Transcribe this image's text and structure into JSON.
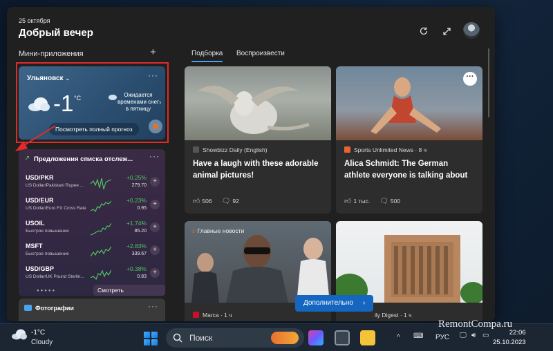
{
  "board": {
    "date": "25 октября",
    "greeting": "Добрый вечер",
    "widgets_title": "Мини-приложения",
    "add_symbol": "+",
    "tabs": [
      {
        "label": "Подборка",
        "active": true
      },
      {
        "label": "Воспроизвести",
        "active": false
      }
    ],
    "header_icons": [
      "refresh-icon",
      "expand-icon",
      "avatar"
    ]
  },
  "weather": {
    "city": "Ульяновск",
    "temp": "-1",
    "unit": "°C",
    "forecast": "Ожидается временами снег в пятницу",
    "button": "Посмотреть полный прогноз",
    "more": "···"
  },
  "watchlist": {
    "title": "Предложения списка отслеж...",
    "more": "···",
    "items": [
      {
        "ticker": "USD/PKR",
        "name": "US Dollar/Pakistani Rupee ...",
        "change": "+0.25%",
        "price": "279.70"
      },
      {
        "ticker": "USD/EUR",
        "name": "US Dollar/Euro FX Cross Rate",
        "change": "+0.23%",
        "price": "0.95"
      },
      {
        "ticker": "USOIL",
        "name": "Быстрое повышение",
        "change": "+1.74%",
        "price": "85.20"
      },
      {
        "ticker": "MSFT",
        "name": "Быстрое повышение",
        "change": "+2.83%",
        "price": "339.67"
      },
      {
        "ticker": "USD/GBP",
        "name": "US Dollar/UK Pound Sterlin...",
        "change": "+0.38%",
        "price": "0.83"
      }
    ],
    "add_symbol": "+",
    "see_more": "Смотреть предложени...",
    "dots": "●●●●●"
  },
  "photos": {
    "title": "Фотографии",
    "more": "···"
  },
  "cards": [
    {
      "source": "Showbizz Daily (English)",
      "headline": "Have a laugh with these adorable animal pictures!",
      "likes": "506",
      "comments": "92"
    },
    {
      "source": "Sports Unlimited News · 8 ч",
      "headline": "Alica Schmidt: The German athlete everyone is talking about",
      "likes": "1 тыс.",
      "comments": "500",
      "menu": "···"
    },
    {
      "badge": "Главные новости",
      "source": "Marca · 1 ч"
    },
    {
      "source": "ily Digest · 1 ч"
    }
  ],
  "more_button": {
    "label": "Дополнительно",
    "arrow": "›"
  },
  "taskbar": {
    "weather_temp": "-1°C",
    "weather_cond": "Cloudy",
    "search_label": "Поиск",
    "language": "РУС",
    "time": "22:06",
    "date": "25.10.2023",
    "chevron": "^"
  },
  "watermark": "RemontCompa.ru",
  "colors": {
    "accent": "#1566c0",
    "positive": "#4fc45f",
    "annotation": "#e12a2a"
  }
}
